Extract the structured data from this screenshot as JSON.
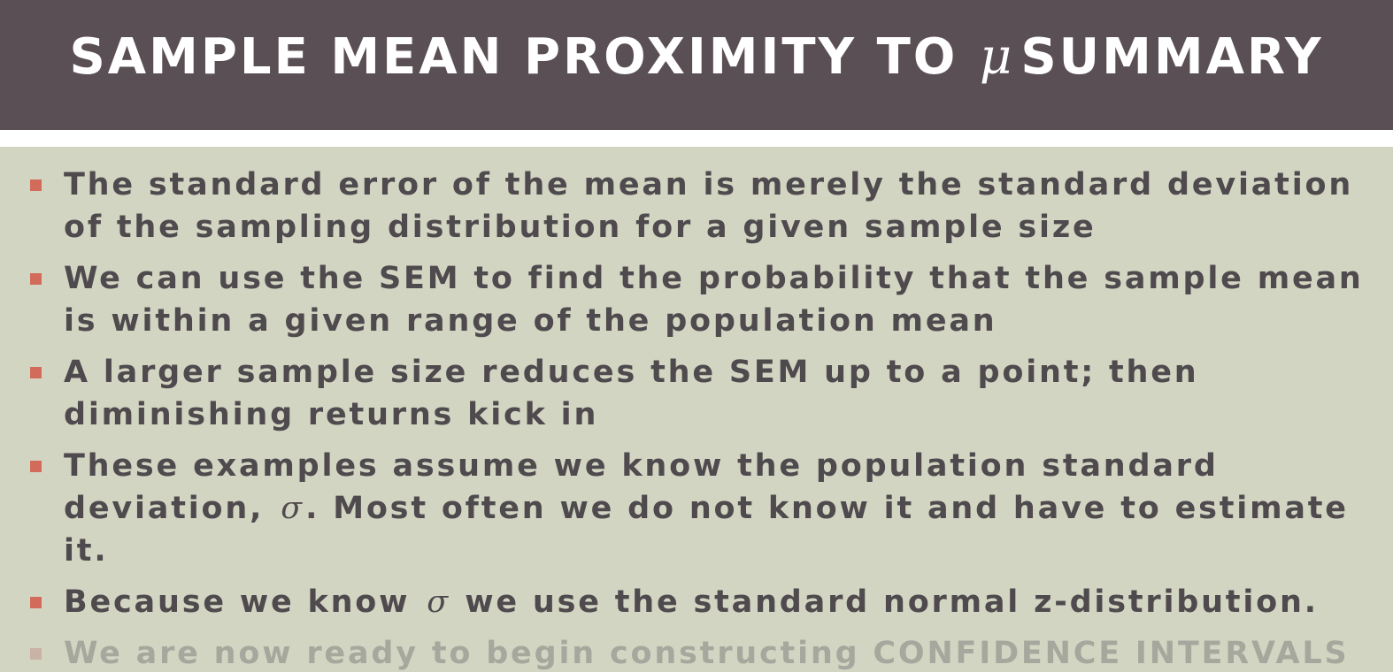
{
  "slide": {
    "title_pre": "SAMPLE MEAN PROXIMITY TO",
    "title_symbol": "μ",
    "title_post": "SUMMARY",
    "bullets": [
      {
        "text": "The standard error of the mean is merely the standard deviation of the sampling distribution for a given sample size"
      },
      {
        "text": "We can use the SEM to find the probability that the sample mean is within a given range of the population mean"
      },
      {
        "text": "A larger sample size reduces the SEM up to a point; then diminishing returns kick in"
      },
      {
        "pre": "These examples assume we know the population standard deviation,",
        "symbol": "σ",
        "post": ". Most often we do not know it and have to estimate it."
      },
      {
        "pre": "Because we know",
        "symbol": "σ",
        "post": "we use the standard normal z-distribution."
      },
      {
        "text": "We are now ready to begin constructing CONFIDENCE INTERVALS"
      }
    ],
    "colors": {
      "title_bar": "#5a4f54",
      "background": "#d3d5c3",
      "bullet_marker": "#d26b5a",
      "body_text": "#4f4a4d"
    }
  }
}
